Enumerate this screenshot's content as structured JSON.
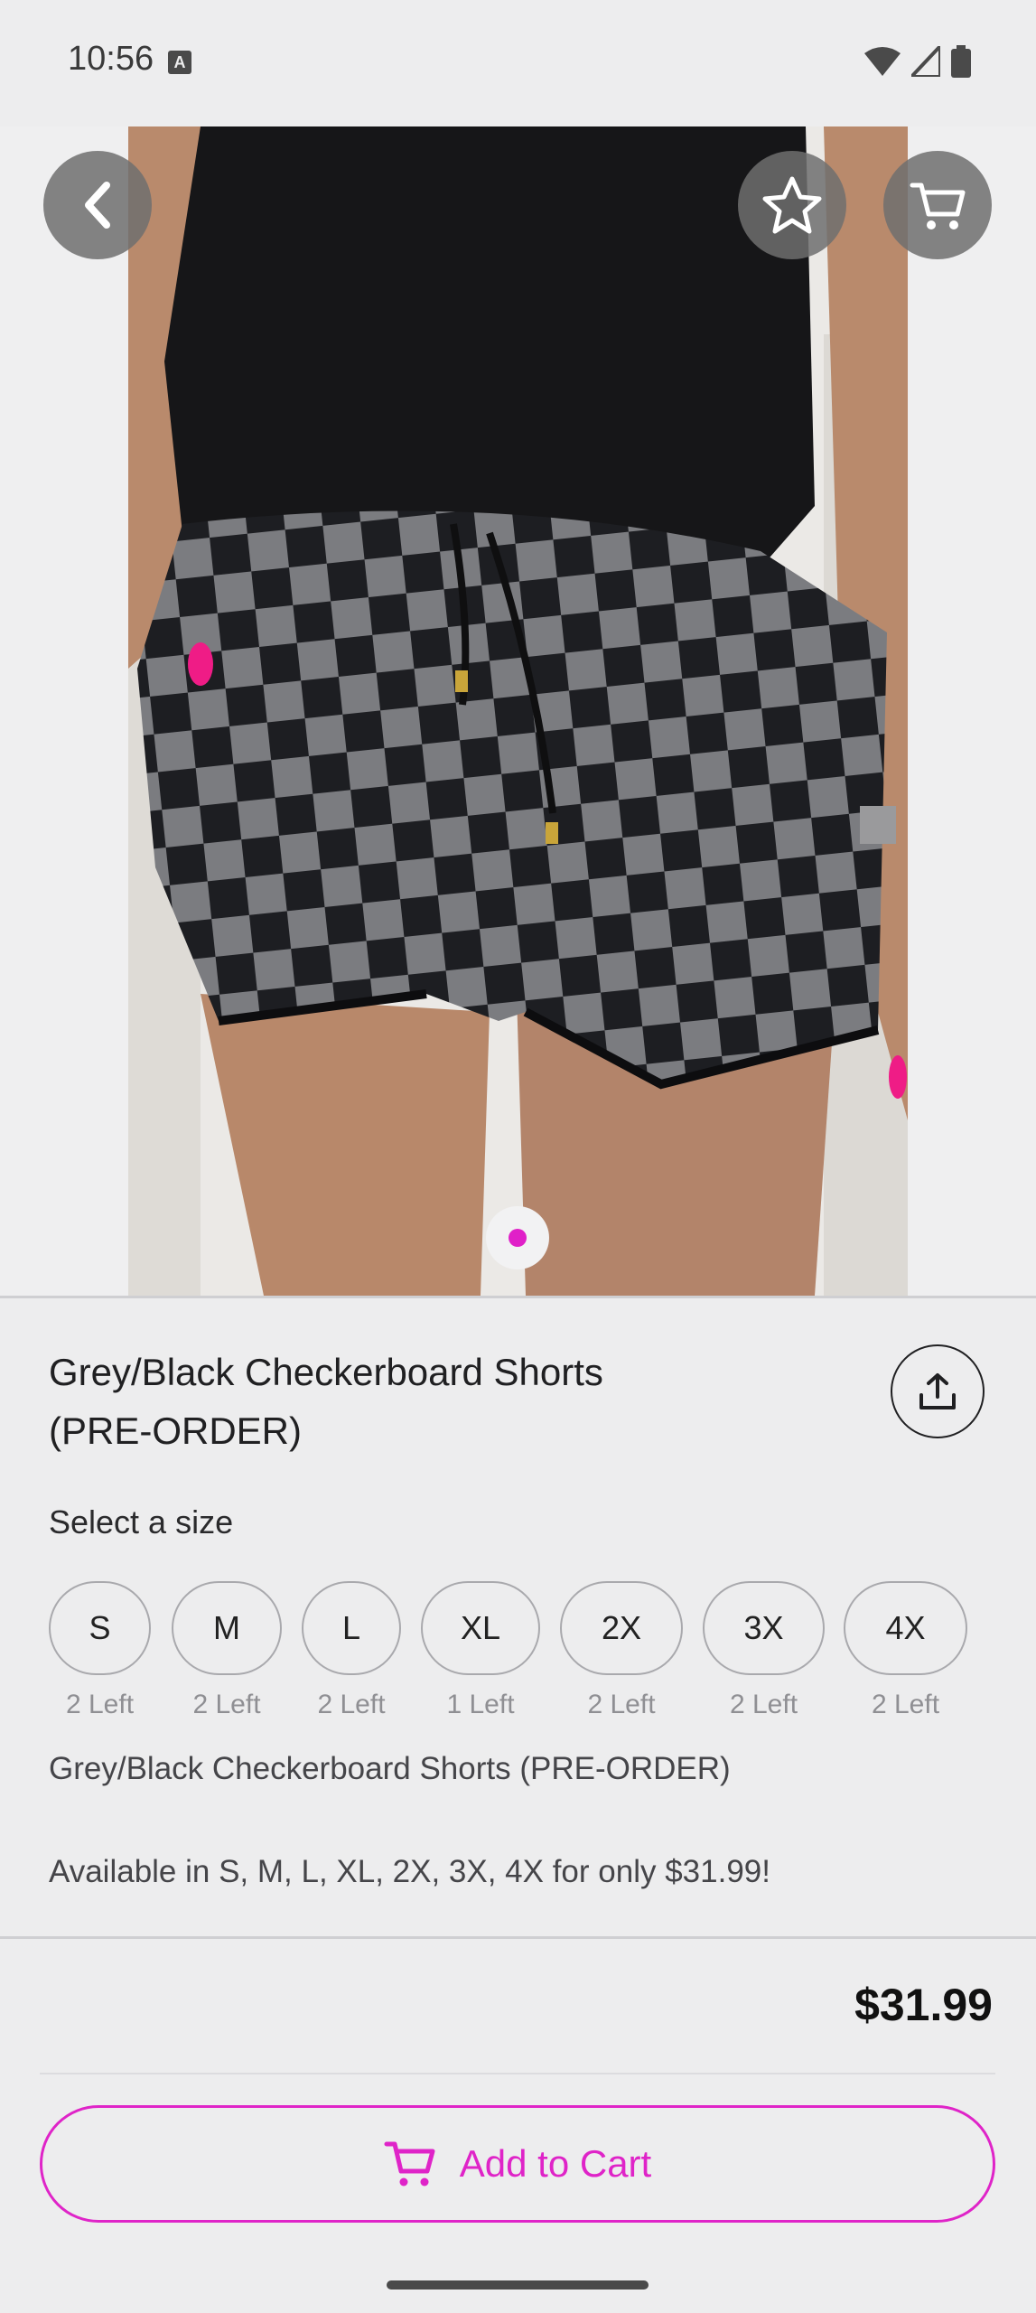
{
  "status_bar": {
    "time": "10:56",
    "a_icon": "A"
  },
  "product": {
    "title": "Grey/Black Checkerboard Shorts (PRE-ORDER)",
    "price": "$31.99",
    "description_line1": "Grey/Black Checkerboard Shorts (PRE-ORDER)",
    "description_line2": "Available in S, M, L, XL, 2X, 3X, 4X for only $31.99!",
    "image_count": 1,
    "active_image_index": 0
  },
  "select_size_label": "Select a size",
  "sizes": [
    {
      "label": "S",
      "left": "2 Left"
    },
    {
      "label": "M",
      "left": "2 Left"
    },
    {
      "label": "L",
      "left": "2 Left"
    },
    {
      "label": "XL",
      "left": "1 Left"
    },
    {
      "label": "2X",
      "left": "2 Left"
    },
    {
      "label": "3X",
      "left": "2 Left"
    },
    {
      "label": "4X",
      "left": "2 Left"
    }
  ],
  "add_to_cart_label": "Add to Cart",
  "colors": {
    "accent": "#df24c8",
    "background": "#ededee"
  },
  "icons": [
    "back-icon",
    "star-icon",
    "cart-icon",
    "share-icon",
    "add-to-cart-icon"
  ]
}
